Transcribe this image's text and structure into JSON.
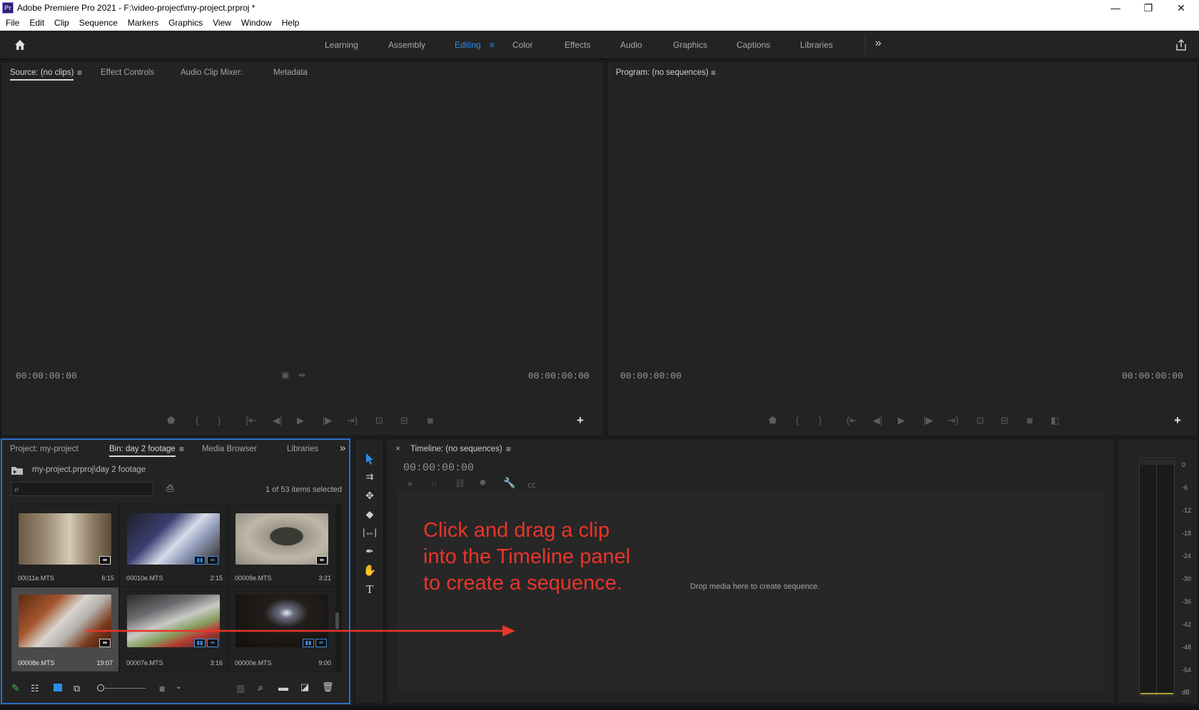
{
  "app": {
    "title": "Adobe Premiere Pro 2021 - F:\\video-project\\my-project.prproj *",
    "logo_text": "Pr",
    "window_controls": {
      "minimize": "—",
      "restore": "❐",
      "close": "✕"
    }
  },
  "menu": [
    "File",
    "Edit",
    "Clip",
    "Sequence",
    "Markers",
    "Graphics",
    "View",
    "Window",
    "Help"
  ],
  "workspaces": {
    "items": [
      "Learning",
      "Assembly",
      "Editing",
      "Color",
      "Effects",
      "Audio",
      "Graphics",
      "Captions",
      "Libraries"
    ],
    "active": "Editing",
    "more": "»"
  },
  "source_panel": {
    "tabs": [
      "Source: (no clips)",
      "Effect Controls",
      "Audio Clip Mixer:",
      "Metadata"
    ],
    "timecode_left": "00:00:00:00",
    "timecode_right": "00:00:00:00"
  },
  "program_panel": {
    "tab": "Program: (no sequences)",
    "timecode_left": "00:00:00:00",
    "timecode_right": "00:00:00:00"
  },
  "project_panel": {
    "tabs": [
      "Project: my-project",
      "Bin: day 2 footage",
      "Media Browser",
      "Libraries"
    ],
    "path": "my-project.prproj\\day 2 footage",
    "search_placeholder": "",
    "items_selected": "1 of 53 items selected",
    "clips": [
      {
        "name": "00011e.MTS",
        "duration": "6:15",
        "selected": false
      },
      {
        "name": "00010e.MTS",
        "duration": "2:15",
        "selected": false
      },
      {
        "name": "00009e.MTS",
        "duration": "3:21",
        "selected": false
      },
      {
        "name": "00008e.MTS",
        "duration": "19:07",
        "selected": true
      },
      {
        "name": "00007e.MTS",
        "duration": "3:16",
        "selected": false
      },
      {
        "name": "00000e.MTS",
        "duration": "9:00",
        "selected": false
      }
    ]
  },
  "timeline_panel": {
    "tab": "Timeline: (no sequences)",
    "close": "×",
    "timecode": "00:00:00:00",
    "drop_hint": "Drop media here to create sequence."
  },
  "annotation": {
    "line1": "Click and drag a clip",
    "line2": "into the Timeline panel",
    "line3": "to create a sequence.",
    "color": "#e8352a"
  },
  "audio_meter": {
    "ticks": [
      "0",
      "-6",
      "-12",
      "-18",
      "-24",
      "-30",
      "-36",
      "-42",
      "-48",
      "-54",
      "dB"
    ]
  },
  "colors": {
    "accent": "#2d8ceb",
    "panel": "#232323",
    "frame": "#1d1d1d"
  }
}
